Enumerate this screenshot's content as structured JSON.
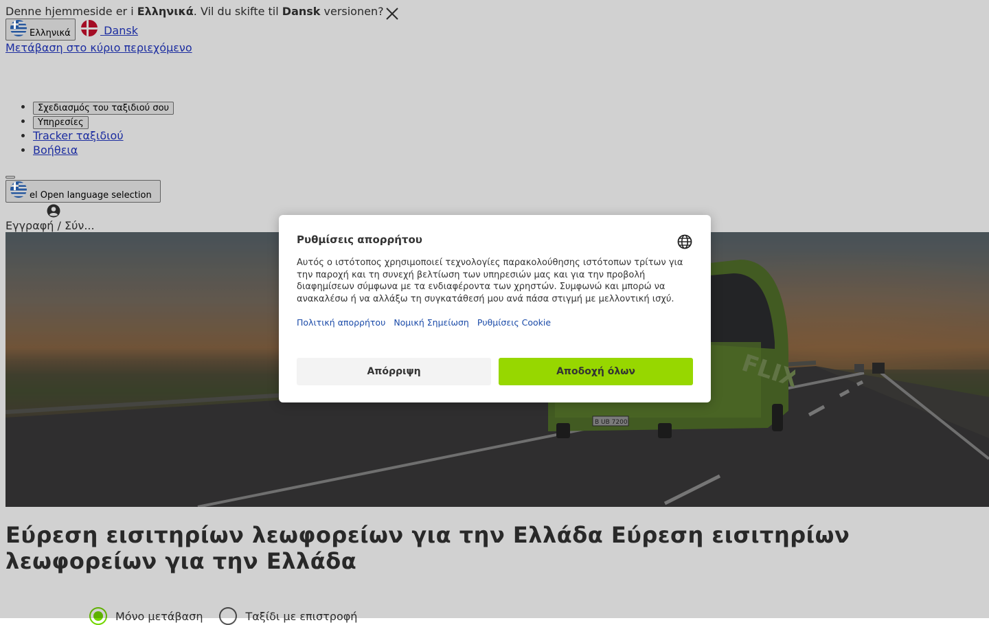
{
  "language_banner": {
    "prefix": "Denne hjemmeside er i ",
    "current_language": "Ελληνικά",
    "middle": ". Vil du skifte til ",
    "target_language": "Dansk",
    "suffix": " versionen?",
    "close_icon": "close-icon"
  },
  "language_options": {
    "greek_label": "Ελληνικά",
    "danish_label": "Dansk"
  },
  "skip_link": "Μετάβαση στο κύριο περιεχόμενο",
  "nav": {
    "items": [
      {
        "label": "Σχεδιασμός του ταξιδιού σου",
        "kind": "button"
      },
      {
        "label": "Υπηρεσίες",
        "kind": "button"
      },
      {
        "label": "Tracker ταξιδιού",
        "kind": "link"
      },
      {
        "label": "Βοήθεια",
        "kind": "link"
      }
    ]
  },
  "language_selector": {
    "label": "el Open language selection"
  },
  "account": {
    "icon": "account-icon",
    "label": "Εγγραφή / Σύν..."
  },
  "hero": {
    "headline": "Εύρεση εισιτηρίων λεωφορείων για την Ελλάδα Εύρεση εισιτηρίων λεωφορείων για την Ελλάδα",
    "bus_plate": "B UB 7200",
    "bus_brand": "FLIXBUS"
  },
  "trip_type": {
    "one_way": "Μόνο μετάβαση",
    "round_trip": "Ταξίδι με επιστροφή",
    "selected": "one_way"
  },
  "consent": {
    "title": "Ρυθμίσεις απορρήτου",
    "globe_icon": "globe-icon",
    "text": "Αυτός ο ιστότοπος χρησιμοποιεί τεχνολογίες παρακολούθησης ιστότοπων τρίτων για την παροχή και τη συνεχή βελτίωση των υπηρεσιών μας και για την προβολή διαφημίσεων σύμφωνα με τα ενδιαφέροντα των χρηστών. Συμφωνώ και μπορώ να ανακαλέσω ή να αλλάξω τη συγκατάθεσή μου ανά πάσα στιγμή με μελλοντική ισχύ.",
    "links": [
      "Πολιτική απορρήτου",
      "Νομική Σημείωση",
      "Ρυθμίσεις Cookie"
    ],
    "deny_label": "Απόρριψη",
    "accept_label": "Αποδοχή όλων",
    "accept_color": "#97d700"
  }
}
